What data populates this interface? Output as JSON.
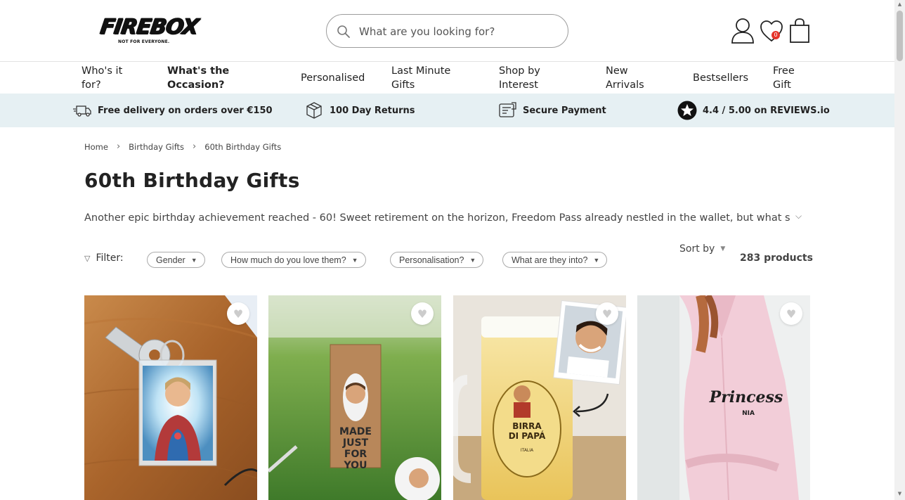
{
  "header": {
    "logo_main": "FIREBOX",
    "logo_tag": "NOT FOR EVERYONE.",
    "search_placeholder": "What are you looking for?",
    "wishlist_count": "0"
  },
  "nav": {
    "items": [
      {
        "label": "Who's it\nfor?"
      },
      {
        "label": "What's the\nOccasion?"
      },
      {
        "label": "Personalised"
      },
      {
        "label": "Last Minute\nGifts"
      },
      {
        "label": "Shop by\nInterest"
      },
      {
        "label": "New\nArrivals"
      },
      {
        "label": "Bestsellers"
      },
      {
        "label": "Free\nGift"
      }
    ]
  },
  "usp": {
    "delivery": "Free delivery on orders over €150",
    "returns": "100 Day Returns",
    "payment": "Secure Payment",
    "reviews": "4.4 / 5.00 on REVIEWS.io"
  },
  "breadcrumb": [
    "Home",
    "Birthday Gifts",
    "60th Birthday Gifts"
  ],
  "page": {
    "title": "60th Birthday Gifts",
    "description": "Another epic birthday achievement reached - 60! Sweet retirement on the horizon, Freedom Pass already nestled in the wallet, but what sort of"
  },
  "filters": {
    "label": "Filter:",
    "options": [
      "Gender",
      "How much do you love them?",
      "Personalisation?",
      "What are they into?"
    ],
    "sort_label": "Sort by",
    "product_count": "283 products"
  },
  "products": [
    {
      "image_text": ""
    },
    {
      "image_text": "MADE JUST FOR YOU"
    },
    {
      "image_text": "BIRRA DI PAPÁ",
      "image_subtext": "ITALIA"
    },
    {
      "image_text": "Princess",
      "image_subtext": "NIA"
    }
  ],
  "colors": {
    "usp_bg": "#e6f0f3",
    "badge": "#e5342a",
    "robe_pink": "#f2cdd8"
  }
}
